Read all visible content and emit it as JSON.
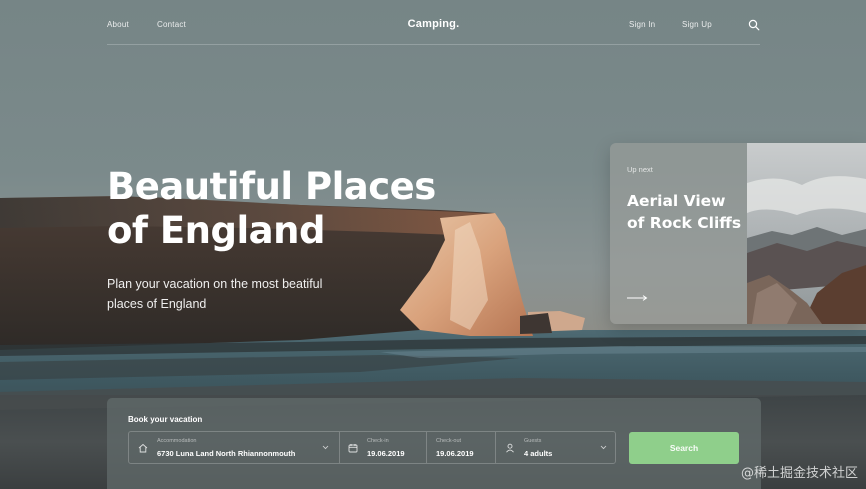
{
  "nav": {
    "about": "About",
    "contact": "Contact",
    "brand": "Camping.",
    "sign_in": "Sign In",
    "sign_up": "Sign Up",
    "search_icon": "search-icon"
  },
  "hero": {
    "title_line1": "Beautiful Places",
    "title_line2": "of England",
    "subtitle": "Plan your vacation on the most beatiful places of England"
  },
  "up_next": {
    "label": "Up next",
    "title": "Aerial View of Rock Cliffs",
    "arrow_icon": "arrow-right-icon"
  },
  "booking": {
    "title": "Book your vacation",
    "accommodation": {
      "label": "Accommodation",
      "value": "6730 Luna Land North Rhiannonmouth",
      "icon": "home-icon"
    },
    "check_in": {
      "label": "Check-in",
      "value": "19.06.2019",
      "icon": "calendar-icon"
    },
    "check_out": {
      "label": "Check-out",
      "value": "19.06.2019"
    },
    "guests": {
      "label": "Guests",
      "value": "4 adults",
      "icon": "user-icon"
    },
    "search_button": "Search"
  },
  "watermark": "@稀土掘金技术社区",
  "colors": {
    "accent_green": "#8fcf8b",
    "panel": "#626c6c"
  }
}
